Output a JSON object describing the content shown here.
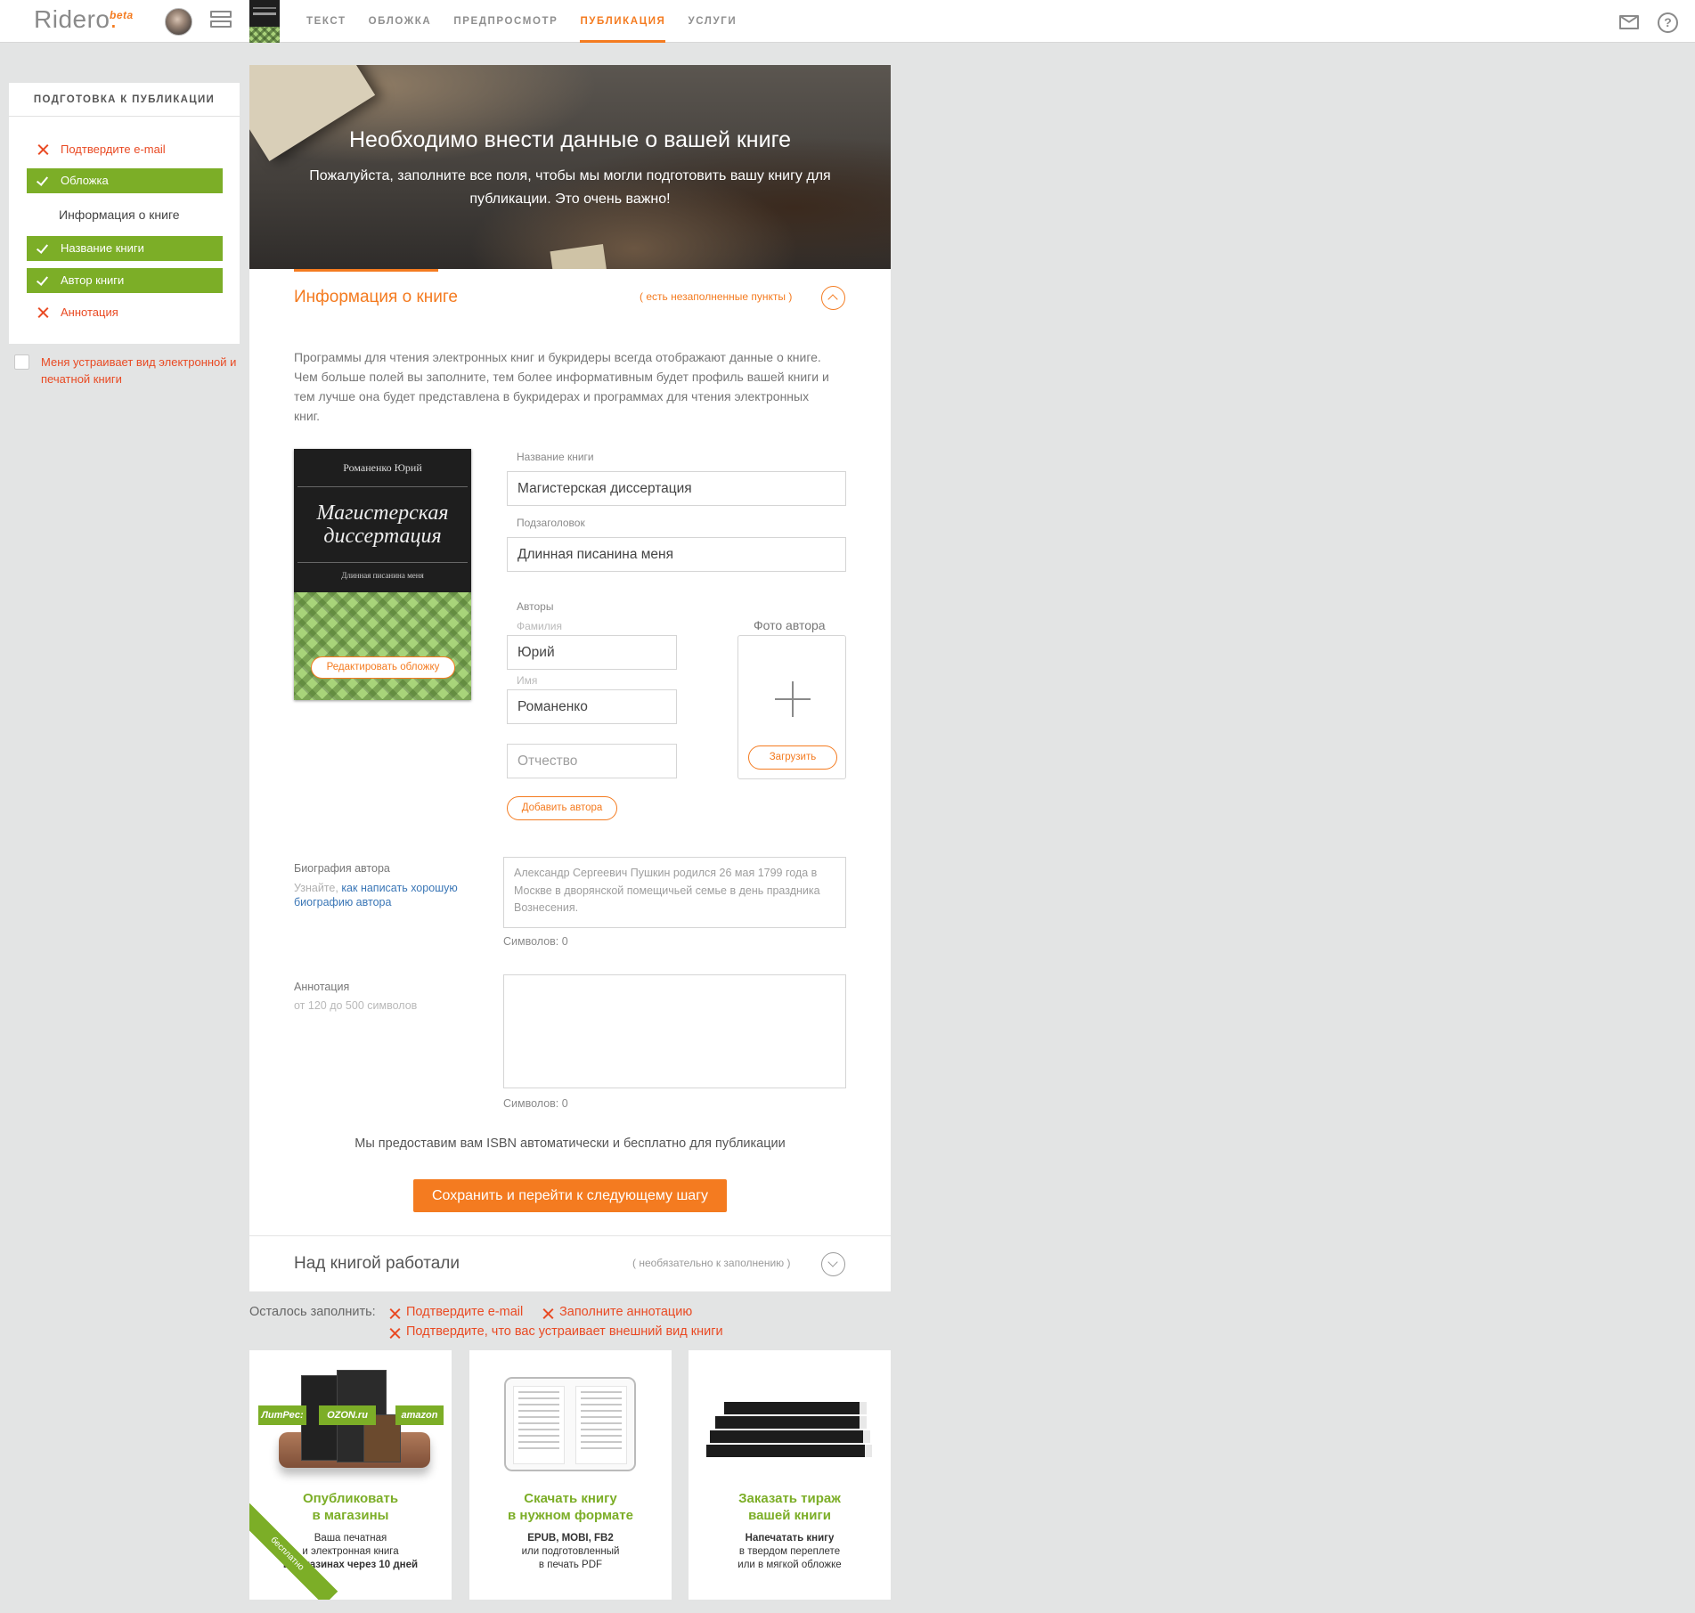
{
  "app": {
    "logo": "Ridero",
    "logo_dot": ".",
    "beta": "beta",
    "help_glyph": "?"
  },
  "nav": {
    "items": [
      {
        "label": "Текст",
        "active": false
      },
      {
        "label": "Обложка",
        "active": false
      },
      {
        "label": "Предпросмотр",
        "active": false
      },
      {
        "label": "Публикация",
        "active": true
      },
      {
        "label": "Услуги",
        "active": false
      }
    ]
  },
  "sidebar": {
    "title": "Подготовка к публикации",
    "steps": [
      {
        "label": "Подтвердите e-mail",
        "state": "todo"
      },
      {
        "label": "Обложка",
        "state": "done"
      },
      {
        "label": "Информация о книге",
        "state": "header"
      },
      {
        "label": "Название книги",
        "state": "done"
      },
      {
        "label": "Автор книги",
        "state": "done"
      },
      {
        "label": "Аннотация",
        "state": "todo"
      }
    ],
    "accept_label": "Меня устраивает вид электронной и печатной книги"
  },
  "hero": {
    "title": "Необходимо внести данные о вашей книге",
    "subtitle": "Пожалуйста, заполните все поля, чтобы мы могли подготовить вашу книгу для публикации. Это очень важно!"
  },
  "book_info": {
    "title": "Информация о книге",
    "note": "( есть незаполненные пункты )",
    "intro": "Программы для чтения электронных книг и букридеры всегда отображают данные о книге. Чем больше полей вы заполните, тем более информативным будет профиль вашей книги и тем лучше она будет представлена в букридерах и программах для чтения электронных книг.",
    "cover": {
      "author": "Романенко Юрий",
      "title": "Магистерская диссертация",
      "subtitle": "Длинная писанина меня",
      "edit_button": "Редактировать обложку"
    },
    "fields": {
      "book_title_label": "Название книги",
      "book_title_value": "Магистерская диссертация",
      "subtitle_label": "Подзаголовок",
      "subtitle_value": "Длинная писанина меня",
      "authors_label": "Авторы",
      "surname_label": "Фамилия",
      "surname_value": "Юрий",
      "name_label": "Имя",
      "name_value": "Романенко",
      "patronymic_placeholder": "Отчество",
      "add_author_button": "Добавить автора",
      "photo_label": "Фото автора",
      "upload_button": "Загрузить"
    },
    "bio": {
      "label": "Биография автора",
      "hint_prefix": "Узнайте,",
      "hint_link": "как написать хорошую биографию автора",
      "placeholder": "Александр Сергеевич Пушкин родился 26 мая 1799 года в Москве в дворянской помещичьей семье в день праздника Вознесения.",
      "count": "Символов: 0"
    },
    "annotation": {
      "label": "Аннотация",
      "hint": "от 120 до 500 символов",
      "count": "Символов: 0"
    },
    "isbn_note": "Мы предоставим вам ISBN автоматически и бесплатно для публикации",
    "save_button": "Сохранить и перейти к следующему шагу"
  },
  "team": {
    "title": "Над книгой работали",
    "note": "( необязательно к заполнению )"
  },
  "remaining": {
    "label": "Осталось заполнить:",
    "items": [
      "Подтвердите e-mail",
      "Заполните аннотацию",
      "Подтвердите, что вас устраивает внешний вид книги"
    ]
  },
  "cards": [
    {
      "title_line1": "Опубликовать",
      "title_line2": "в магазины",
      "text_line1": "Ваша печатная",
      "text_line2": "и электронная книга",
      "text_line3": "в магазинах через 10 дней",
      "ribbon": "бесплатно",
      "stores": [
        "ЛитРес:",
        "OZON.ru",
        "amazon"
      ]
    },
    {
      "title_line1": "Скачать книгу",
      "title_line2": "в нужном формате",
      "text_line1": "EPUB, MOBI, FB2",
      "text_line2": "или подготовленный",
      "text_line3": "в печать PDF"
    },
    {
      "title_line1": "Заказать тираж",
      "title_line2": "вашей книги",
      "text_line1": "Напечатать книгу",
      "text_line2": "в твердом переплете",
      "text_line3": "или в мягкой обложке"
    }
  ],
  "colors": {
    "accent": "#f47b20",
    "success": "#7cae27",
    "error": "#e94a23",
    "link": "#3a76b6"
  }
}
